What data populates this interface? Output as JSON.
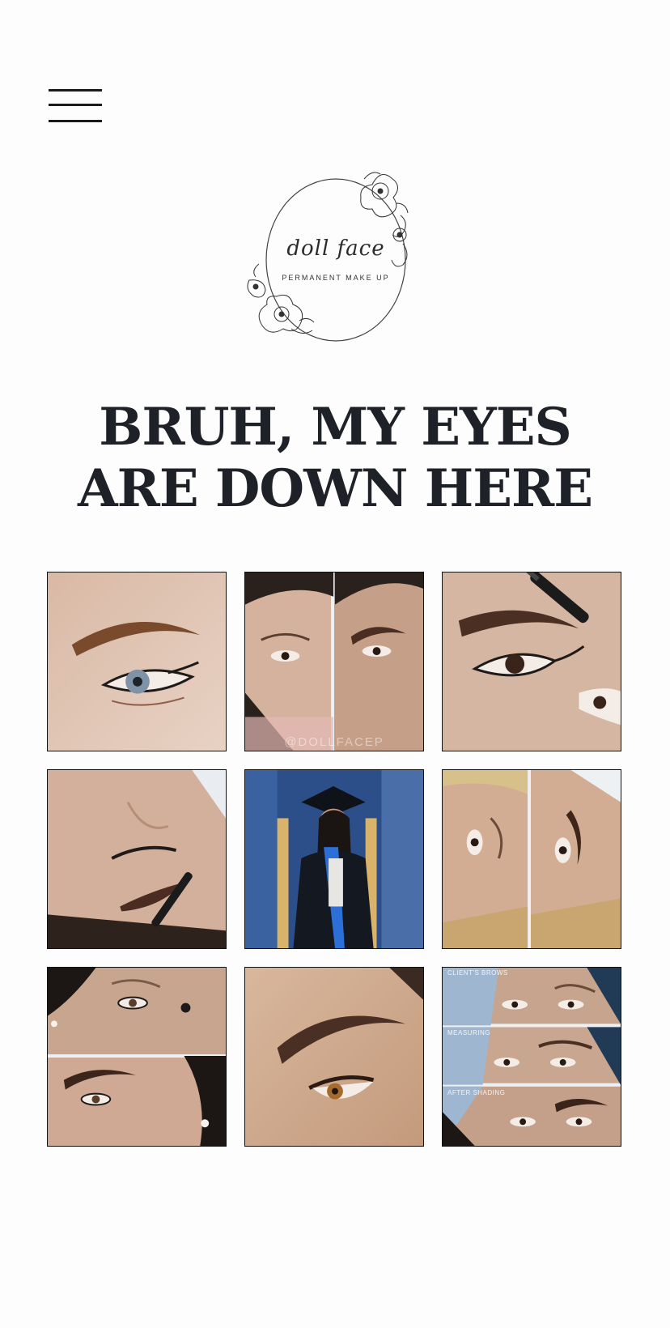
{
  "header": {
    "menu_icon": "hamburger-menu-icon"
  },
  "logo": {
    "script_text": "doll face",
    "subtitle": "PERMANENT MAKE UP",
    "decoration_icon": "peony-flower-wreath"
  },
  "hero": {
    "headline": "BRUH, MY EYES ARE DOWN HERE"
  },
  "gallery": {
    "images": [
      {
        "description": "Microbladed brown eyebrow above blue eye with winged liner"
      },
      {
        "description": "Before and after comparison of eyebrows"
      },
      {
        "description": "Eyebrow groomed with spoolie brush"
      },
      {
        "description": "Client lying down with brow spoolie, upside down view"
      },
      {
        "description": "Graduate in cap and gown with blue stole"
      },
      {
        "description": "Before and after comparison of brows, client lying down"
      },
      {
        "description": "Two-panel brow comparison with pearl earring"
      },
      {
        "description": "Close-up of finished brow and lashes"
      },
      {
        "description": "Three-step brow progression"
      }
    ],
    "watermark": "@DOLLFACEP",
    "captions": {
      "step1": "CLIENT'S BROWS",
      "step2": "MEASURING",
      "step3": "AFTER SHADING"
    }
  },
  "colors": {
    "headline": "#1f2128",
    "background": "#fdfdfd",
    "border": "#111111"
  }
}
